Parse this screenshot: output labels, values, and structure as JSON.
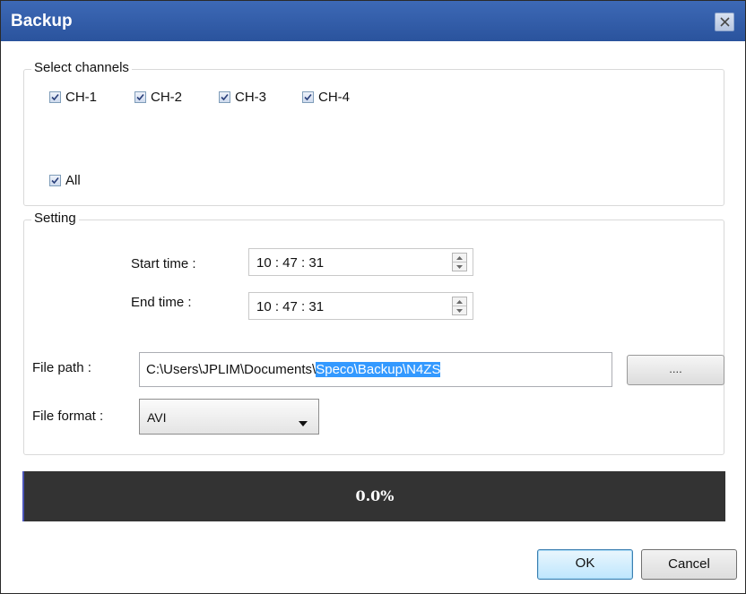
{
  "window": {
    "title": "Backup"
  },
  "channels": {
    "group_title": "Select channels",
    "items": [
      {
        "label": "CH-1",
        "checked": true
      },
      {
        "label": "CH-2",
        "checked": true
      },
      {
        "label": "CH-3",
        "checked": true
      },
      {
        "label": "CH-4",
        "checked": true
      }
    ],
    "all": {
      "label": "All",
      "checked": true
    }
  },
  "setting": {
    "group_title": "Setting",
    "start_time": {
      "label": "Start time :",
      "value": "10 : 47 : 31"
    },
    "end_time": {
      "label": "End time :",
      "value": "10 : 47 : 31"
    },
    "file_path": {
      "label": "File path :",
      "value_unselected": "C:\\Users\\JPLIM\\Documents\\",
      "value_selected": "Speco\\Backup\\N4ZS",
      "browse_label": "...."
    },
    "file_format": {
      "label": "File format :",
      "value": "AVI"
    }
  },
  "progress": {
    "value": 0.0,
    "text": "0.0%"
  },
  "buttons": {
    "ok": "OK",
    "cancel": "Cancel"
  },
  "colors": {
    "titlebar": "#2b55a0",
    "progress_bg": "#333333",
    "progress_fill": "#4a54b8",
    "selection": "#3399ff"
  }
}
